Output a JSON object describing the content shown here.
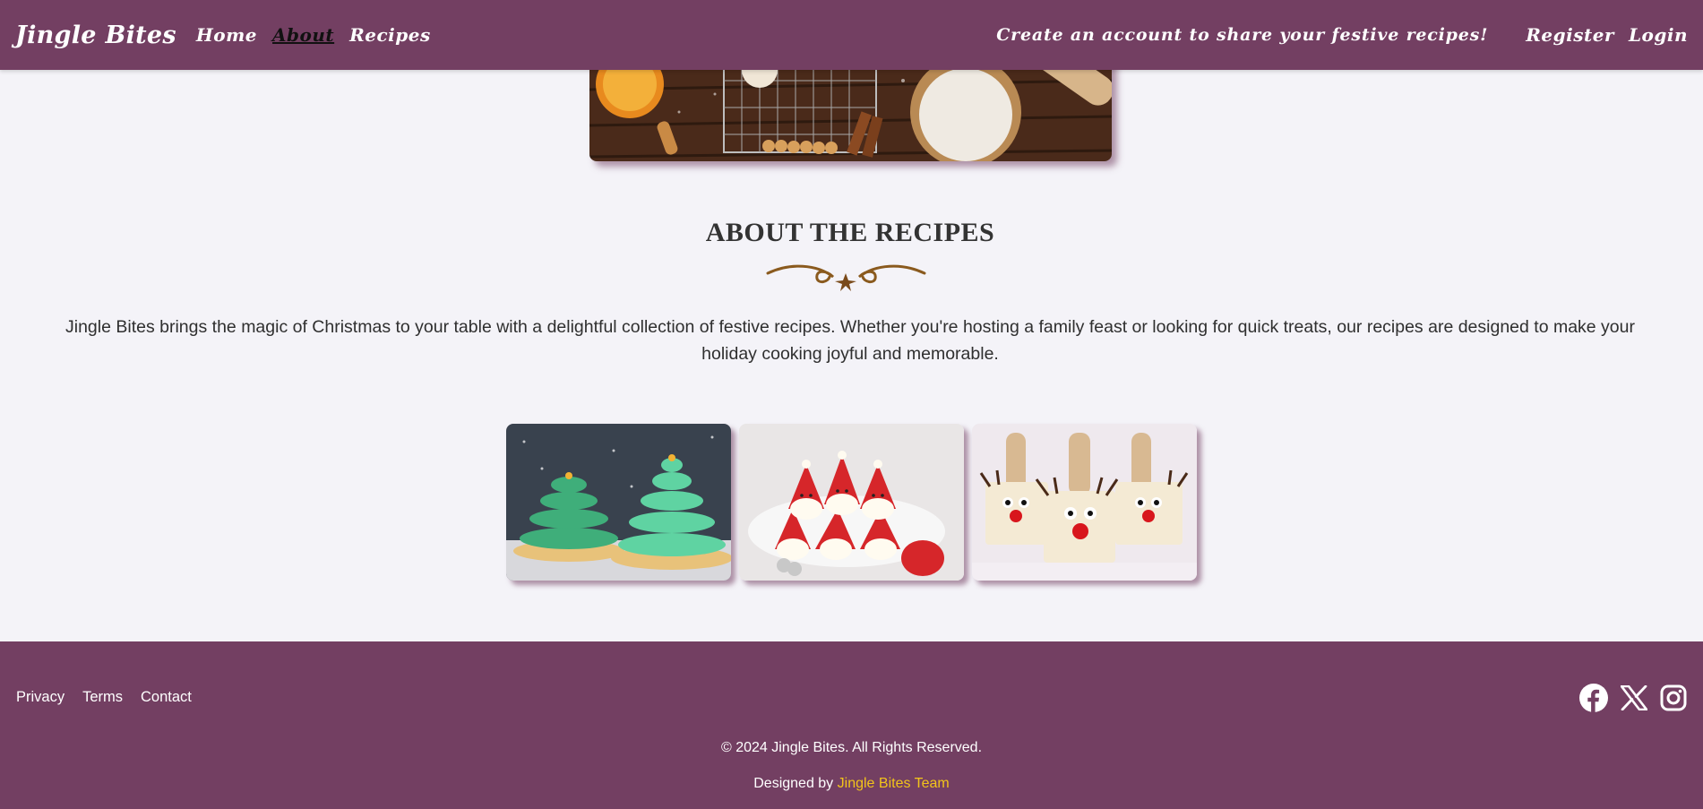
{
  "header": {
    "brand": "Jingle Bites",
    "nav": [
      {
        "label": "Home",
        "active": false
      },
      {
        "label": "About",
        "active": true
      },
      {
        "label": "Recipes",
        "active": false
      }
    ],
    "promo": "Create an account to share your festive recipes!",
    "register": "Register",
    "login": "Login"
  },
  "about": {
    "title": "ABOUT THE RECIPES",
    "text": "Jingle Bites brings the magic of Christmas to your table with a delightful collection of festive recipes. Whether you're hosting a family feast or looking for quick treats, our recipes are designed to make your holiday cooking joyful and memorable."
  },
  "gallery": [
    {
      "icon": "christmas-tree-cookies-image"
    },
    {
      "icon": "strawberry-santas-image"
    },
    {
      "icon": "reindeer-rice-krispie-treats-image"
    }
  ],
  "footer": {
    "links": [
      "Privacy",
      "Terms",
      "Contact"
    ],
    "socials": [
      "facebook-icon",
      "x-icon",
      "instagram-icon"
    ],
    "copyright": "© 2024 Jingle Bites. All Rights Reserved.",
    "designed_prefix": "Designed by",
    "team": "Jingle Bites Team"
  },
  "colors": {
    "primary": "#733f62",
    "background": "#f4f3f8",
    "accent": "#f2c41a"
  }
}
